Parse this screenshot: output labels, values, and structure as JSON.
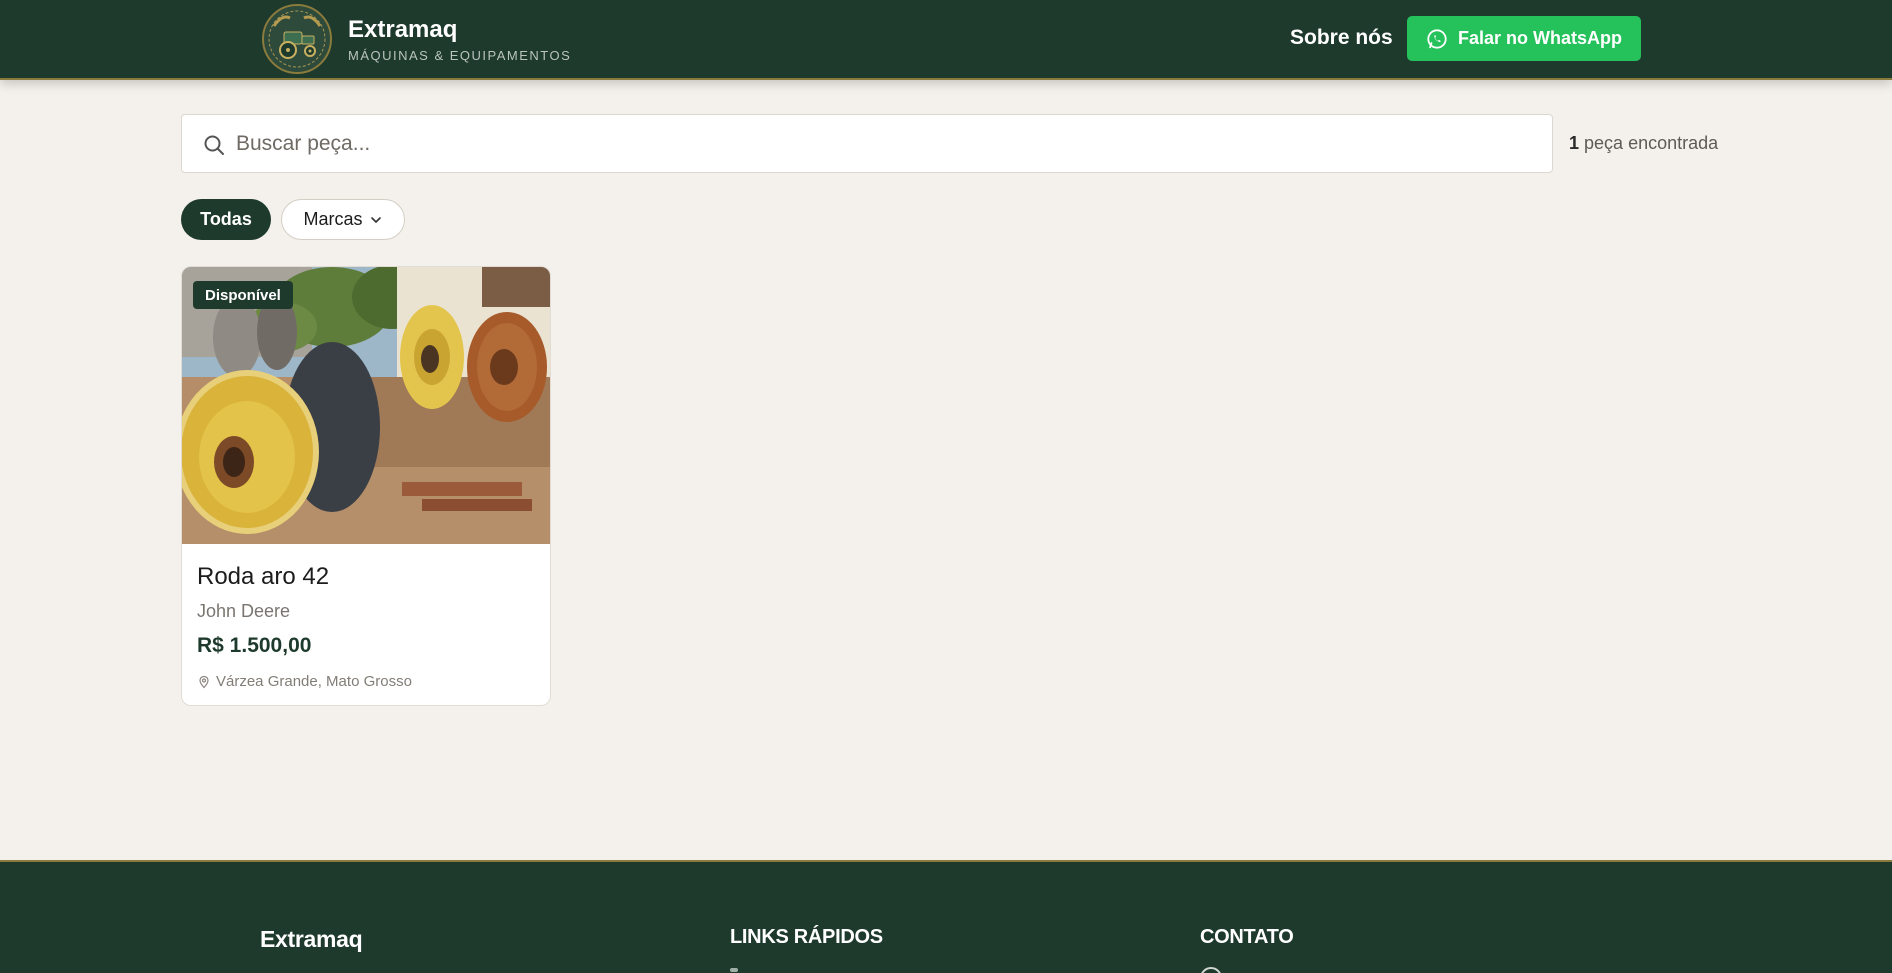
{
  "header": {
    "brand_name": "Extramaq",
    "brand_subtitle": "MÁQUINAS & EQUIPAMENTOS",
    "about_label": "Sobre nós",
    "whatsapp_label": "Falar no WhatsApp"
  },
  "search": {
    "placeholder": "Buscar peça...",
    "result_count": "1",
    "result_label": "peça encontrada"
  },
  "filters": {
    "all_label": "Todas",
    "brands_label": "Marcas"
  },
  "products": [
    {
      "badge": "Disponível",
      "title": "Roda aro 42",
      "brand": "John Deere",
      "price": "R$ 1.500,00",
      "location": "Várzea Grande, Mato Grosso"
    }
  ],
  "footer": {
    "brand": "Extramaq",
    "links_heading": "LINKS RÁPIDOS",
    "contact_heading": "CONTATO"
  },
  "colors": {
    "primary": "#1e3a2d",
    "whatsapp": "#25c15a",
    "background": "#f4f1ec",
    "accent_gold": "#8a7a3c"
  }
}
